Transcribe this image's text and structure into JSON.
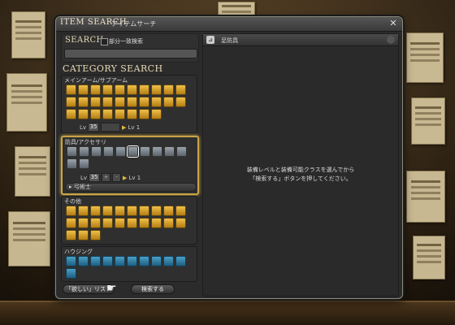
{
  "window": {
    "title_en": "ITEM SEARCH",
    "title_jp": "アイテムサーチ",
    "close_icon": "close-x-icon"
  },
  "search": {
    "label": "SEARCH",
    "partial_match_label": "部分一致検索",
    "partial_match_checked": false,
    "input_value": "",
    "input_placeholder": ""
  },
  "category": {
    "label": "CATEGORY SEARCH",
    "groups": {
      "weapons": {
        "title": "メインアーム/サブアーム",
        "icons": [
          "sword",
          "axe",
          "spear",
          "bow",
          "staff",
          "book",
          "fist",
          "sword2",
          "lance",
          "tool1",
          "tool2",
          "tool3",
          "tool4",
          "tool5",
          "tool6",
          "shield",
          "gather1",
          "gather2",
          "gather3",
          "gather4",
          "gather5",
          "gather6",
          "craft1",
          "craft2",
          "craft3",
          "craft4",
          "craft5",
          "craft6"
        ],
        "lv_label": "Lv",
        "lv_value": "35",
        "lv_max": "Lv 1"
      },
      "armor": {
        "title": "防具/アクセサリ",
        "icons": [
          "head",
          "body",
          "hands",
          "waist",
          "legs",
          "feet",
          "ring",
          "neck",
          "ear",
          "wrist",
          "shield",
          "belt"
        ],
        "selected_icon": "feet",
        "lv_label": "Lv",
        "lv_value": "35",
        "lv_minus": "-",
        "lv_plus": "+",
        "lv_max": "Lv 1",
        "class_label": "弓術士"
      },
      "other": {
        "title": "その他",
        "icons": [
          "food",
          "potion",
          "medicine",
          "material1",
          "material2",
          "stone",
          "metal",
          "wood",
          "cloth",
          "leather",
          "bone",
          "reagent",
          "ingredient",
          "crystal",
          "catalyst",
          "misc",
          "dye",
          "part",
          "furnish",
          "seeds",
          "minion",
          "chocobo",
          "triad"
        ]
      },
      "housing": {
        "title": "ハウジング",
        "icons": [
          "h1",
          "h2",
          "h3",
          "h4",
          "h5",
          "h6",
          "h7",
          "h8",
          "h9",
          "h10",
          "h11"
        ]
      }
    }
  },
  "buttons": {
    "wishlist": "「欲しい」リスト",
    "search": "検索する"
  },
  "results": {
    "header": "足防具",
    "message_line1": "装備レベルと装備可能クラスを選んでから",
    "message_line2": "「検索する」ボタンを押してください。"
  },
  "colors": {
    "gold_accent": "#c9a447",
    "icon_gold": "#f0c04a",
    "icon_blue": "#4aa0c8"
  }
}
